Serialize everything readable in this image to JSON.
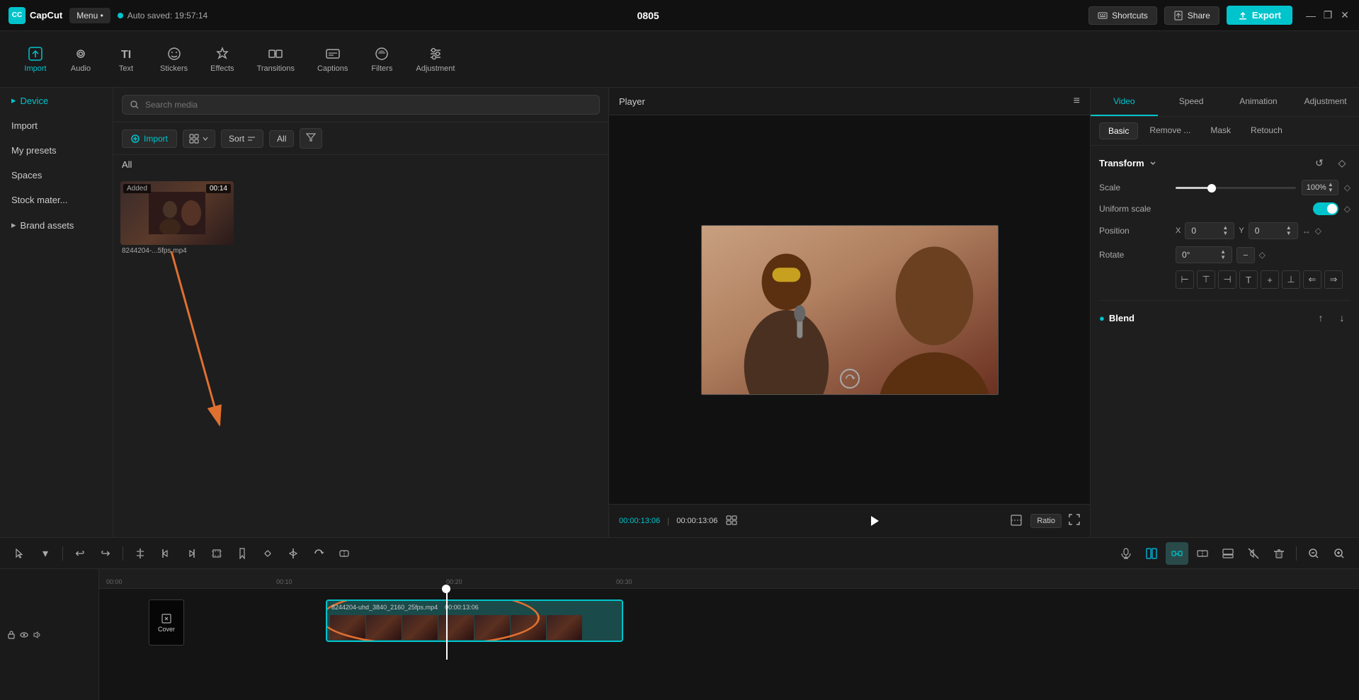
{
  "app": {
    "logo": "CapCut",
    "menu_label": "Menu •",
    "autosave": "Auto saved: 19:57:14",
    "project_name": "0805"
  },
  "topbar": {
    "shortcuts_label": "Shortcuts",
    "share_label": "Share",
    "export_label": "Export",
    "window_controls": [
      "—",
      "❐",
      "✕"
    ]
  },
  "toolbar": {
    "items": [
      {
        "id": "import",
        "label": "Import",
        "active": true
      },
      {
        "id": "audio",
        "label": "Audio",
        "active": false
      },
      {
        "id": "text",
        "label": "Text",
        "active": false
      },
      {
        "id": "stickers",
        "label": "Stickers",
        "active": false
      },
      {
        "id": "effects",
        "label": "Effects",
        "active": false
      },
      {
        "id": "transitions",
        "label": "Transitions",
        "active": false
      },
      {
        "id": "captions",
        "label": "Captions",
        "active": false
      },
      {
        "id": "filters",
        "label": "Filters",
        "active": false
      },
      {
        "id": "adjustment",
        "label": "Adjustment",
        "active": false
      }
    ]
  },
  "left_panel": {
    "items": [
      {
        "id": "device",
        "label": "Device",
        "active": true,
        "arrow": "▸"
      },
      {
        "id": "import",
        "label": "Import",
        "active": false
      },
      {
        "id": "my-presets",
        "label": "My presets",
        "active": false
      },
      {
        "id": "spaces",
        "label": "Spaces",
        "active": false
      },
      {
        "id": "stock-material",
        "label": "Stock mater...",
        "active": false
      },
      {
        "id": "brand-assets",
        "label": "Brand assets",
        "active": false,
        "arrow": "▸"
      }
    ]
  },
  "media_panel": {
    "search_placeholder": "Search media",
    "import_label": "Import",
    "sort_label": "Sort",
    "all_label": "All",
    "filter_label": "⋮",
    "all_filter_label": "All",
    "media_items": [
      {
        "id": "video1",
        "name": "8244204-...5fps.mp4",
        "duration": "00:14",
        "added": true
      }
    ]
  },
  "player": {
    "title": "Player",
    "time_current": "00:00:13:06",
    "time_total": "00:00:13:06",
    "ratio_label": "Ratio"
  },
  "right_panel": {
    "tabs": [
      {
        "id": "video",
        "label": "Video",
        "active": true
      },
      {
        "id": "speed",
        "label": "Speed",
        "active": false
      },
      {
        "id": "animation",
        "label": "Animation",
        "active": false
      },
      {
        "id": "adjustment",
        "label": "Adjustment",
        "active": false
      }
    ],
    "subtabs": [
      {
        "id": "basic",
        "label": "Basic",
        "active": true
      },
      {
        "id": "remove-bg",
        "label": "Remove ...",
        "active": false
      },
      {
        "id": "mask",
        "label": "Mask",
        "active": false
      },
      {
        "id": "retouch",
        "label": "Retouch",
        "active": false
      }
    ],
    "transform": {
      "section_title": "Transform",
      "scale_label": "Scale",
      "scale_value": "100%",
      "uniform_scale_label": "Uniform scale",
      "position_label": "Position",
      "position_x_label": "X",
      "position_x_value": "0",
      "position_y_label": "Y",
      "position_y_value": "0",
      "rotate_label": "Rotate",
      "rotate_value": "0°",
      "rotate_minus": "−"
    },
    "blend": {
      "section_title": "Blend"
    }
  },
  "timeline": {
    "clip": {
      "name": "8244204-uhd_3840_2160_25fps.mp4",
      "duration": "00:00:13:06"
    },
    "cover_label": "Cover",
    "ruler_marks": [
      "00:00",
      "00:10",
      "00:20",
      "00:30"
    ]
  }
}
